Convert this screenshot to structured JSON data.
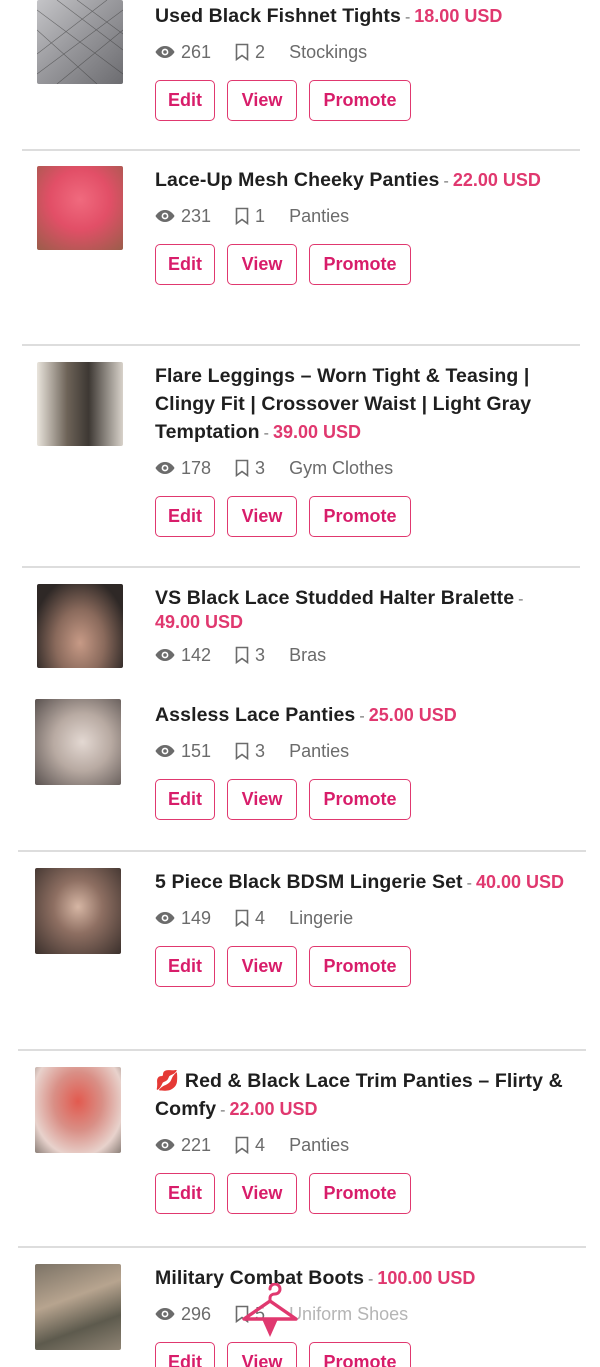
{
  "listings": [
    {
      "title": "Used Black Fishnet Tights",
      "separator": "-",
      "price": "18.00 USD",
      "views": "261",
      "saves": "2",
      "category": "Stockings",
      "thumb_color": "#a9a9ad",
      "buttons": {
        "edit": "Edit",
        "view": "View",
        "promote": "Promote"
      }
    },
    {
      "title": "Lace-Up Mesh Cheeky Panties",
      "separator": "-",
      "price": "22.00 USD",
      "views": "231",
      "saves": "1",
      "category": "Panties",
      "thumb_color": "#e46477",
      "buttons": {
        "edit": "Edit",
        "view": "View",
        "promote": "Promote"
      }
    },
    {
      "title": "Flare Leggings – Worn Tight & Teasing | Clingy Fit | Crossover Waist | Light Gray Temptation",
      "separator": "-",
      "price": "39.00 USD",
      "views": "178",
      "saves": "3",
      "category": "Gym Clothes",
      "thumb_color": "#8b8178",
      "buttons": {
        "edit": "Edit",
        "view": "View",
        "promote": "Promote"
      }
    },
    {
      "title": "VS Black Lace Studded Halter Bralette",
      "separator": "-",
      "price": "49.00 USD",
      "views": "142",
      "saves": "3",
      "category": "Bras",
      "thumb_color": "#5c4a43"
    },
    {
      "title": "Assless Lace Panties",
      "separator": "-",
      "price": "25.00 USD",
      "views": "151",
      "saves": "3",
      "category": "Panties",
      "thumb_color": "#b9b0ab",
      "buttons": {
        "edit": "Edit",
        "view": "View",
        "promote": "Promote"
      }
    },
    {
      "title": "5 Piece Black BDSM Lingerie Set",
      "separator": "-",
      "price": "40.00 USD",
      "views": "149",
      "saves": "4",
      "category": "Lingerie",
      "thumb_color": "#6f5a52",
      "buttons": {
        "edit": "Edit",
        "view": "View",
        "promote": "Promote"
      }
    },
    {
      "title": "💋 Red & Black Lace Trim Panties – Flirty & Comfy",
      "separator": "-",
      "price": "22.00 USD",
      "views": "221",
      "saves": "4",
      "category": "Panties",
      "thumb_color": "#d9868a",
      "buttons": {
        "edit": "Edit",
        "view": "View",
        "promote": "Promote"
      }
    },
    {
      "title": "Military Combat Boots",
      "separator": "-",
      "price": "100.00 USD",
      "views": "296",
      "saves": "5",
      "category": "Uniform Shoes",
      "thumb_color": "#6a6255",
      "buttons": {
        "edit": "Edit",
        "view": "View",
        "promote": "Promote"
      }
    }
  ],
  "colors": {
    "accent": "#e0386f",
    "button_text": "#d81d6a",
    "meta_text": "#6b6b6b",
    "divider": "#dddddd"
  },
  "icons": {
    "views": "eye-icon",
    "saves": "bookmark-icon",
    "fab": "hanger-icon"
  }
}
